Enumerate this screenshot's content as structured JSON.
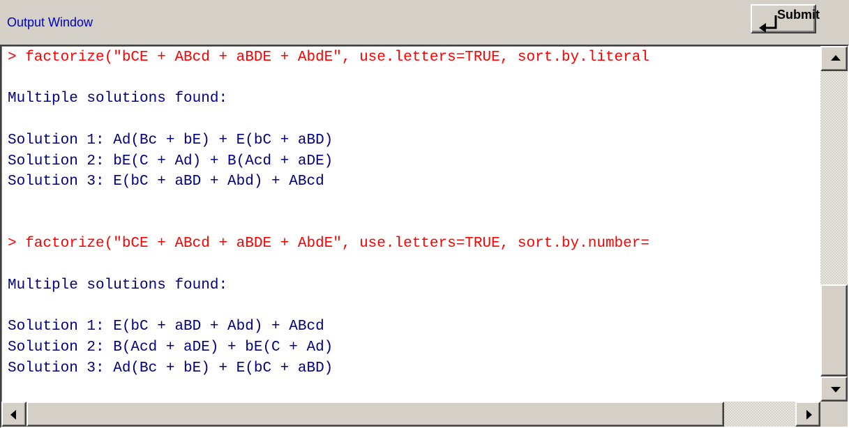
{
  "window": {
    "title": "Output Window",
    "submit_label": "Submit"
  },
  "output": {
    "lines": [
      {
        "kind": "cmd",
        "text": "> factorize(\"bCE + ABcd + aBDE + AbdE\", use.letters=TRUE, sort.by.literal"
      },
      {
        "kind": "out",
        "text": ""
      },
      {
        "kind": "out",
        "text": "Multiple solutions found:"
      },
      {
        "kind": "out",
        "text": ""
      },
      {
        "kind": "out",
        "text": "Solution 1: Ad(Bc + bE) + E(bC + aBD)"
      },
      {
        "kind": "out",
        "text": "Solution 2: bE(C + Ad) + B(Acd + aDE)"
      },
      {
        "kind": "out",
        "text": "Solution 3: E(bC + aBD + Abd) + ABcd"
      },
      {
        "kind": "out",
        "text": ""
      },
      {
        "kind": "out",
        "text": ""
      },
      {
        "kind": "cmd",
        "text": "> factorize(\"bCE + ABcd + aBDE + AbdE\", use.letters=TRUE, sort.by.number="
      },
      {
        "kind": "out",
        "text": ""
      },
      {
        "kind": "out",
        "text": "Multiple solutions found:"
      },
      {
        "kind": "out",
        "text": ""
      },
      {
        "kind": "out",
        "text": "Solution 1: E(bC + aBD + Abd) + ABcd"
      },
      {
        "kind": "out",
        "text": "Solution 2: B(Acd + aDE) + bE(C + Ad)"
      },
      {
        "kind": "out",
        "text": "Solution 3: Ad(Bc + bE) + E(bC + aBD)"
      }
    ]
  },
  "colors": {
    "title": "#0000c0",
    "command": "#ff0000",
    "output": "#000080",
    "chrome": "#d4d0c8"
  },
  "icons": {
    "submit": "enter-arrow-icon",
    "scroll_up": "arrow-up-icon",
    "scroll_down": "arrow-down-icon",
    "scroll_left": "arrow-left-icon",
    "scroll_right": "arrow-right-icon"
  }
}
